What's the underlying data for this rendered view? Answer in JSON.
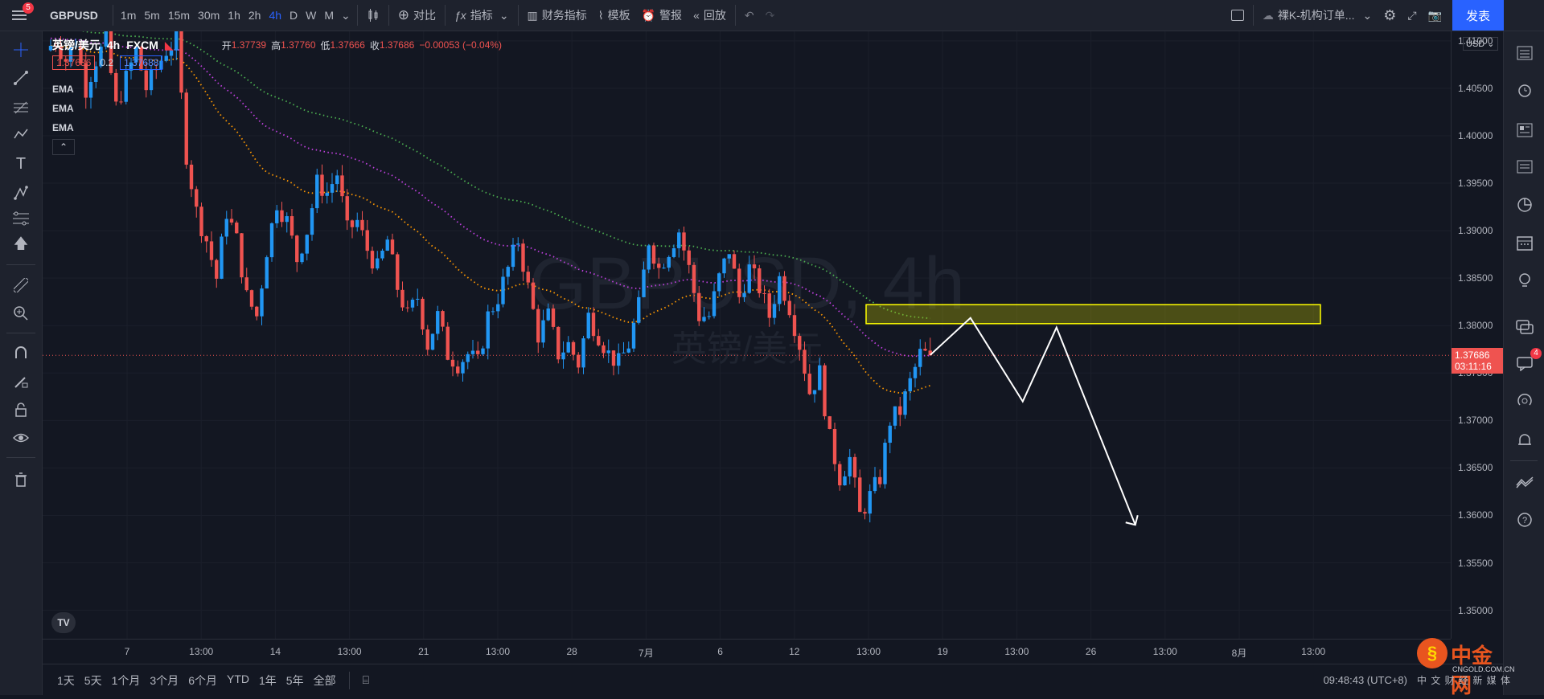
{
  "topbar": {
    "notif_count": "5",
    "symbol": "GBPUSD",
    "timeframes": [
      "1m",
      "5m",
      "15m",
      "30m",
      "1h",
      "2h",
      "4h",
      "D",
      "W",
      "M"
    ],
    "active_timeframe": "4h",
    "compare": "对比",
    "indicators": "指标",
    "financials": "财务指标",
    "templates": "模板",
    "alert": "警报",
    "replay": "回放",
    "layout_name": "裸K-机构订单...",
    "publish": "发表"
  },
  "legend": {
    "name": "英镑/美元",
    "interval": "4h",
    "exchange": "FXCM",
    "open_label": "开",
    "open": "1.37739",
    "high_label": "高",
    "high": "1.37760",
    "low_label": "低",
    "low": "1.37666",
    "close_label": "收",
    "close": "1.37686",
    "change": "−0.00053 (−0.04%)",
    "bid": "1.37686",
    "spread": "0.2",
    "ask": "1.37688",
    "ema_labels": [
      "EMA",
      "EMA",
      "EMA"
    ]
  },
  "watermark": {
    "symbol": "GBPUSD, 4h",
    "name": "英镑/美元"
  },
  "price_axis": {
    "currency": "USD",
    "ticks": [
      "1.41000",
      "1.40500",
      "1.40000",
      "1.39500",
      "1.39000",
      "1.38500",
      "1.38000",
      "1.37500",
      "1.37000",
      "1.36500",
      "1.36000",
      "1.35500",
      "1.35000"
    ],
    "current_price": "1.37686",
    "countdown": "03:11:16"
  },
  "time_axis": {
    "ticks": [
      "7",
      "13:00",
      "14",
      "13:00",
      "21",
      "13:00",
      "28",
      "7月",
      "6",
      "12",
      "13:00",
      "19",
      "13:00",
      "26",
      "13:00",
      "8月",
      "13:00"
    ]
  },
  "bottombar": {
    "ranges": [
      "1天",
      "5天",
      "1个月",
      "3个月",
      "6个月",
      "YTD",
      "1年",
      "5年",
      "全部"
    ],
    "clock": "09:48:43 (UTC+8)"
  },
  "branding": {
    "logo_text": "中金网",
    "logo_url_text": "CNGOLD.COM.CN",
    "footer_text": "中 文 财 经 新 媒 体"
  },
  "right_toolbar": {
    "chat_badge": "4"
  },
  "colors": {
    "background": "#131722",
    "up": "#2196f3",
    "down": "#ef5350",
    "ema_fast": "#ff9800",
    "ema_mid": "#c040e0",
    "ema_slow": "#4caf50",
    "zone": "#ffff00",
    "accent": "#2962ff"
  },
  "chart_data": {
    "type": "candlestick",
    "title": "英镑/美元 4h FXCM",
    "ylim": [
      1.347,
      1.411
    ],
    "ticks_y": [
      1.41,
      1.405,
      1.4,
      1.395,
      1.39,
      1.385,
      1.38,
      1.375,
      1.37,
      1.365,
      1.36,
      1.355,
      1.35
    ],
    "close_path": [
      1.409,
      1.41,
      1.408,
      1.41,
      1.405,
      1.408,
      1.41,
      1.403,
      1.406,
      1.409,
      1.405,
      1.407,
      1.409,
      1.41,
      1.398,
      1.392,
      1.389,
      1.385,
      1.392,
      1.389,
      1.383,
      1.381,
      1.388,
      1.393,
      1.391,
      1.387,
      1.39,
      1.395,
      1.394,
      1.396,
      1.39,
      1.391,
      1.388,
      1.386,
      1.389,
      1.384,
      1.381,
      1.383,
      1.378,
      1.381,
      1.377,
      1.376,
      1.377,
      1.376,
      1.381,
      1.383,
      1.386,
      1.389,
      1.384,
      1.379,
      1.381,
      1.377,
      1.378,
      1.376,
      1.381,
      1.379,
      1.377,
      1.376,
      1.378,
      1.382,
      1.389,
      1.386,
      1.388,
      1.39,
      1.386,
      1.381,
      1.381,
      1.385,
      1.388,
      1.383,
      1.386,
      1.384,
      1.381,
      1.385,
      1.382,
      1.378,
      1.373,
      1.375,
      1.368,
      1.364,
      1.366,
      1.36,
      1.362,
      1.364,
      1.37,
      1.371,
      1.374,
      1.377,
      1.3769
    ],
    "ema_fast_end": 1.3752,
    "ema_mid_end": 1.3782,
    "ema_slow_end": 1.3808,
    "zone": {
      "y_top": 1.3822,
      "y_bottom": 1.3802
    },
    "projection": [
      1.3769,
      1.3808,
      1.372,
      1.3798,
      1.359
    ]
  }
}
